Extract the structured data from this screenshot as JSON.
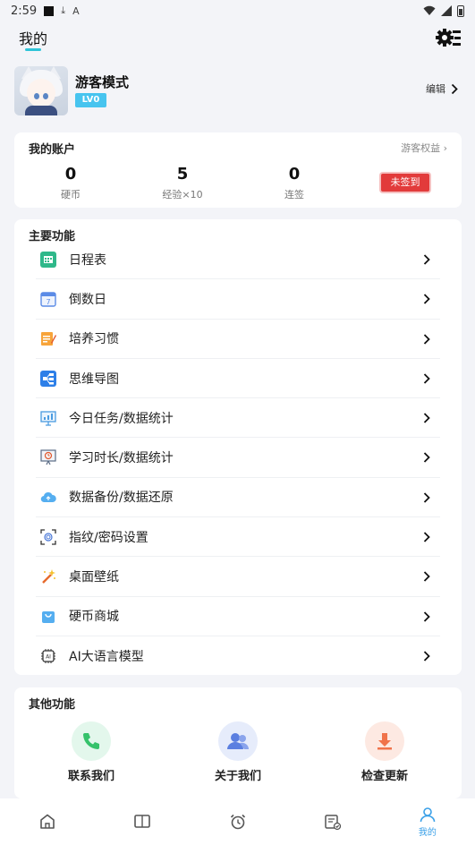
{
  "status_bar": {
    "time": "2:59",
    "glyph_1": "⤓",
    "glyph_2": "A"
  },
  "header": {
    "title": "我的"
  },
  "profile": {
    "name": "游客模式",
    "level": "LV0",
    "edit_label": "编辑"
  },
  "account": {
    "title": "我的账户",
    "perks_label": "游客权益",
    "stats": [
      {
        "value": "0",
        "label": "硬币"
      },
      {
        "value": "5",
        "label": "经验×10"
      },
      {
        "value": "0",
        "label": "连签"
      }
    ],
    "checkin_label": "未签到"
  },
  "main_functions": {
    "title": "主要功能",
    "items": [
      {
        "label": "日程表",
        "icon": "calendar-grid-icon"
      },
      {
        "label": "倒数日",
        "icon": "calendar-7-icon"
      },
      {
        "label": "培养习惯",
        "icon": "habit-pencil-icon"
      },
      {
        "label": "思维导图",
        "icon": "mindmap-icon"
      },
      {
        "label": "今日任务/数据统计",
        "icon": "chart-board-icon"
      },
      {
        "label": "学习时长/数据统计",
        "icon": "timer-board-icon"
      },
      {
        "label": "数据备份/数据还原",
        "icon": "cloud-icon"
      },
      {
        "label": "指纹/密码设置",
        "icon": "fingerprint-icon"
      },
      {
        "label": "桌面壁纸",
        "icon": "magic-wand-icon"
      },
      {
        "label": "硬币商城",
        "icon": "shopping-bag-icon"
      },
      {
        "label": "AI大语言模型",
        "icon": "ai-chip-icon"
      }
    ]
  },
  "other_functions": {
    "title": "其他功能",
    "items": [
      {
        "label": "联系我们",
        "icon": "phone-icon",
        "bg": "#e3f7ec",
        "fg": "#35c26b"
      },
      {
        "label": "关于我们",
        "icon": "users-icon",
        "bg": "#e6ecfb",
        "fg": "#5b7fe0"
      },
      {
        "label": "检查更新",
        "icon": "download-icon",
        "bg": "#fde9e2",
        "fg": "#f0734a"
      }
    ]
  },
  "tabbar": {
    "active_label": "我的",
    "accent": "#3aa0e8",
    "tabs": [
      "home-icon",
      "book-icon",
      "alarm-clock-icon",
      "task-list-icon",
      "profile-icon"
    ]
  }
}
